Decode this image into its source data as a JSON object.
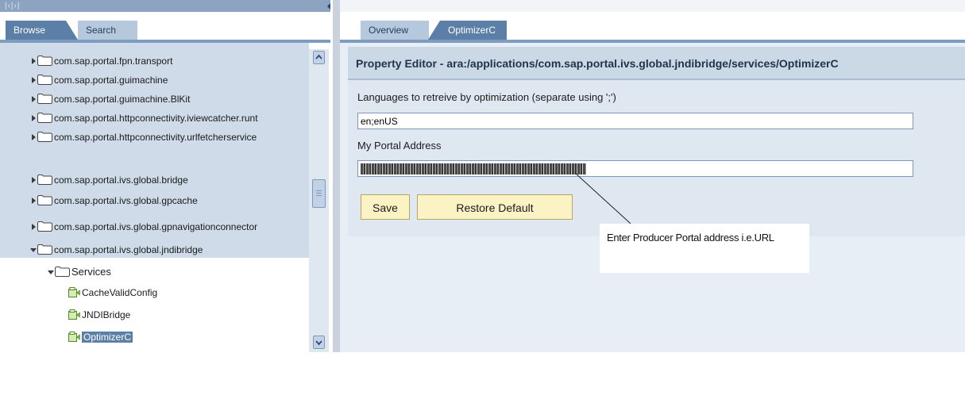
{
  "left_pane": {
    "tabs": [
      {
        "label": "Browse"
      },
      {
        "label": "Search"
      }
    ],
    "tree": [
      {
        "label": "com.sap.portal.fpn.transport",
        "type": "folder",
        "expanded": false
      },
      {
        "label": "com.sap.portal.guimachine",
        "type": "folder",
        "expanded": false
      },
      {
        "label": "com.sap.portal.guimachine.BlKit",
        "type": "folder",
        "expanded": false
      },
      {
        "label": "com.sap.portal.httpconnectivity.iviewcatcher.runt",
        "type": "folder",
        "expanded": false
      },
      {
        "label": "com.sap.portal.httpconnectivity.urlfetcherservice",
        "type": "folder",
        "expanded": false
      },
      {
        "label": "com.sap.portal.ivs.global.bridge",
        "type": "folder",
        "expanded": false
      },
      {
        "label": "com.sap.portal.ivs.global.gpcache",
        "type": "folder",
        "expanded": false
      },
      {
        "label": "com.sap.portal.ivs.global.gpnavigationconnector",
        "type": "folder",
        "expanded": false
      },
      {
        "label": "com.sap.portal.ivs.global.jndibridge",
        "type": "folder",
        "expanded": true
      },
      {
        "label": "Services",
        "type": "folder",
        "expanded": true
      },
      {
        "label": "CacheValidConfig",
        "type": "service"
      },
      {
        "label": "JNDIBridge",
        "type": "service"
      },
      {
        "label": "OptimizerC",
        "type": "service",
        "selected": true
      }
    ]
  },
  "right_pane": {
    "tabs": [
      {
        "label": "Overview"
      },
      {
        "label": "OptimizerC"
      }
    ],
    "editor": {
      "title": "Property Editor - ara:/applications/com.sap.portal.ivs.global.jndibridge/services/OptimizerC",
      "fields": [
        {
          "label": "Languages to retreive by optimization (separate using ';')",
          "value": "en;enUS"
        },
        {
          "label": "My Portal Address",
          "value": ""
        }
      ],
      "buttons": {
        "save": "Save",
        "restore": "Restore Default"
      }
    },
    "callout": "Enter Producer Portal address i.e.URL"
  },
  "colors": {
    "tab_active": "#5b7fa7",
    "tab_inactive": "#b6c8dc",
    "tree_highlight": "#cfdbe8",
    "button_bg": "#fbf3c4",
    "editor_bg": "#dfe7f0"
  },
  "icons": [
    "chevron-right-icon",
    "chevron-down-icon",
    "folder-icon",
    "service-icon",
    "scroll-up-icon",
    "scroll-down-icon"
  ]
}
